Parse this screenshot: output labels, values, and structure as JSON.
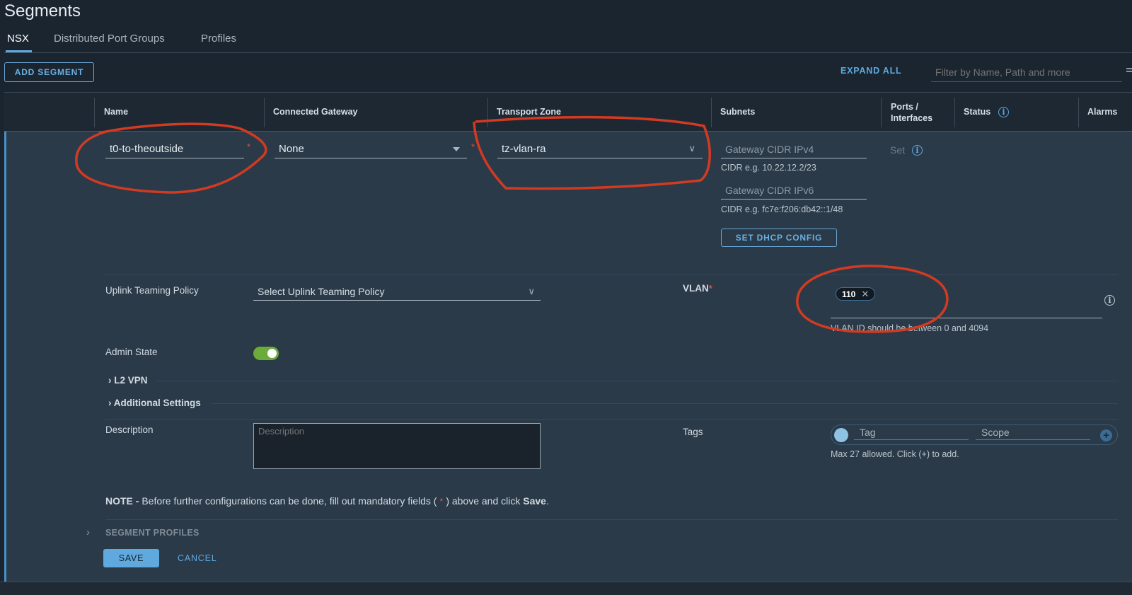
{
  "page": {
    "title": "Segments"
  },
  "tabs": [
    {
      "label": "NSX",
      "active": true
    },
    {
      "label": "Distributed Port Groups"
    },
    {
      "label": "Profiles"
    }
  ],
  "toolbar": {
    "add_segment": "ADD SEGMENT",
    "expand_all": "EXPAND ALL",
    "filter_placeholder": "Filter by Name, Path and more"
  },
  "table": {
    "headers": [
      "Name",
      "Connected Gateway",
      "Transport Zone",
      "Subnets",
      "Ports /",
      "Interfaces",
      "Status",
      "Alarms"
    ]
  },
  "row": {
    "name": "t0-to-theoutside",
    "gateway": "None",
    "transport_zone": "tz-vlan-ra",
    "ipv4_placeholder": "Gateway CIDR IPv4",
    "ipv4_hint": "CIDR e.g. 10.22.12.2/23",
    "ipv6_placeholder": "Gateway CIDR IPv6",
    "ipv6_hint": "CIDR e.g. fc7e:f206:db42::1/48",
    "dhcp_button": "SET DHCP CONFIG",
    "ports_set": "Set",
    "required_mark": "*"
  },
  "form": {
    "uplink_label": "Uplink Teaming Policy",
    "uplink_placeholder": "Select Uplink Teaming Policy",
    "vlan_label": "VLAN",
    "vlan_chip": "110",
    "vlan_hint": "VLAN ID should be between 0 and 4094",
    "admin_state_label": "Admin State",
    "admin_state_on": true,
    "l2vpn": "L2 VPN",
    "additional": "Additional Settings",
    "description_label": "Description",
    "description_placeholder": "Description",
    "tags_label": "Tags",
    "tag_placeholder": "Tag",
    "scope_placeholder": "Scope",
    "tags_hint": "Max 27 allowed. Click (+) to add.",
    "note_bold": "NOTE -",
    "note_text": "Before further configurations can be done, fill out mandatory fields (",
    "note_star": "*",
    "note_text2": ") above and click",
    "note_save": "Save",
    "note_end": ".",
    "segment_profiles": "SEGMENT PROFILES",
    "save": "SAVE",
    "cancel": "CANCEL"
  },
  "colors": {
    "accent": "#5fa9e0",
    "annotation": "#d23a22",
    "toggle": "#6aab3a"
  }
}
